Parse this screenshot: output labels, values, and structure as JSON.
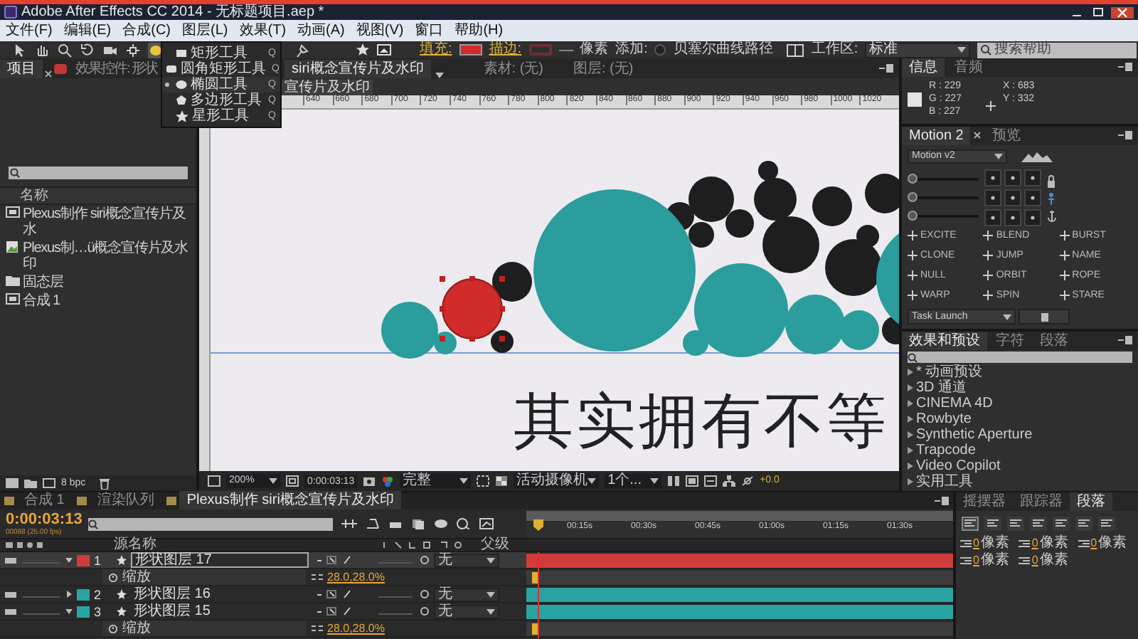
{
  "window": {
    "title": "Adobe After Effects CC 2014 - 无标题项目.aep *"
  },
  "menu": [
    "文件(F)",
    "编辑(E)",
    "合成(C)",
    "图层(L)",
    "效果(T)",
    "动画(A)",
    "视图(V)",
    "窗口",
    "帮助(H)"
  ],
  "toolbar": {
    "fill_label": "填充:",
    "stroke_label": "描边:",
    "stroke_unit": "像素",
    "add_label": "添加:",
    "bezier": {
      "label": "贝塞尔曲线路径",
      "checked": false
    },
    "workspace_label": "工作区:",
    "workspace": "标准",
    "search_placeholder": "搜索帮助"
  },
  "shape_menu": [
    {
      "kind": "rectangle",
      "label": "矩形工具",
      "shortcut": "Q",
      "selected": false
    },
    {
      "kind": "rounded_rectangle",
      "label": "圆角矩形工具",
      "shortcut": "Q",
      "selected": false
    },
    {
      "kind": "ellipse",
      "label": "椭圆工具",
      "shortcut": "Q",
      "selected": true
    },
    {
      "kind": "polygon",
      "label": "多边形工具",
      "shortcut": "Q",
      "selected": false
    },
    {
      "kind": "star",
      "label": "星形工具",
      "shortcut": "Q",
      "selected": false
    }
  ],
  "project_panel": {
    "tabs": [
      {
        "label": "项目",
        "selected": true
      },
      {
        "label": "效果控件: 形状",
        "selected": false
      }
    ],
    "column": "名称",
    "items": [
      {
        "kind": "composition",
        "name": "Plexus制作 siri概念宣传片及水"
      },
      {
        "kind": "footage",
        "name": "Plexus制…ü概念宣传片及水印"
      },
      {
        "kind": "folder",
        "name": "固态层"
      },
      {
        "kind": "composition",
        "name": "合成 1"
      }
    ],
    "bpc": "8 bpc"
  },
  "composition_panel": {
    "tabs": [
      {
        "label": "siri概念宣传片及水印",
        "selected": true
      },
      {
        "label": "素材: (无)",
        "selected": false
      },
      {
        "label": "图层: (无)",
        "selected": false
      }
    ],
    "breadcrumb": "宣传片及水印",
    "ruler": [
      "640",
      "660",
      "680",
      "700",
      "720",
      "740",
      "760",
      "780",
      "800",
      "820",
      "840",
      "860",
      "880",
      "900",
      "920",
      "940",
      "960",
      "980",
      "1000",
      "1020"
    ],
    "canvas_text": "其实拥有不等",
    "zoom": "200%",
    "time": "0:00:03:13",
    "resolution": "完整",
    "camera": "活动摄像机",
    "views": "1个...",
    "exposure": "+0.0"
  },
  "info_panel": {
    "tabs": [
      {
        "label": "信息",
        "selected": true
      },
      {
        "label": "音频",
        "selected": false
      }
    ],
    "color_values": [
      "R : 229",
      "G : 227",
      "B : 227"
    ],
    "position": [
      "X : 683",
      "Y : 332"
    ]
  },
  "motion_panel": {
    "tabs": [
      {
        "label": "Motion 2",
        "selected": true
      },
      {
        "label": "预览",
        "selected": false
      }
    ],
    "preset": "Motion v2",
    "sliders": [
      {
        "level": 0
      },
      {
        "level": 0
      },
      {
        "level": 0
      }
    ],
    "tools": [
      "EXCITE",
      "BLEND",
      "BURST",
      "CLONE",
      "JUMP",
      "NAME",
      "NULL",
      "ORBIT",
      "ROPE",
      "WARP",
      "SPIN",
      "STARE"
    ],
    "launcher": "Task Launch"
  },
  "effects_panel": {
    "tabs": [
      {
        "label": "效果和预设",
        "selected": true
      },
      {
        "label": "字符",
        "selected": false
      },
      {
        "label": "段落",
        "selected": false
      }
    ],
    "items": [
      "* 动画预设",
      "3D 通道",
      "CINEMA 4D",
      "Rowbyte",
      "Synthetic Aperture",
      "Trapcode",
      "Video Copilot",
      "实用工具"
    ]
  },
  "timeline": {
    "tabs": [
      {
        "label": "合成 1",
        "selected": false
      },
      {
        "label": "渲染队列",
        "selected": false
      },
      {
        "label": "Plexus制作 siri概念宣传片及水印",
        "selected": true
      }
    ],
    "time": "0:00:03:13",
    "frame": "00088 (25.00 fps)",
    "columns": [
      "源名称",
      "父级"
    ],
    "ruler": [
      "00:15s",
      "00:30s",
      "00:45s",
      "01:00s",
      "01:15s",
      "01:30s"
    ],
    "layers": [
      {
        "kind": "layer",
        "number": "1",
        "name": "形状图层 17",
        "color": "#d23b3b",
        "expanded": true,
        "selected": true,
        "parent": "无"
      },
      {
        "kind": "property",
        "name": "缩放",
        "value": "28.0,28.0%"
      },
      {
        "kind": "layer",
        "number": "2",
        "name": "形状图层 16",
        "color": "#2aa3a3",
        "expanded": false,
        "selected": false,
        "parent": "无"
      },
      {
        "kind": "layer",
        "number": "3",
        "name": "形状图层 15",
        "color": "#2aa3a3",
        "expanded": true,
        "selected": false,
        "parent": "无"
      },
      {
        "kind": "property",
        "name": "缩放",
        "value": "28.0,28.0%"
      }
    ]
  },
  "paragraph_panel": {
    "tabs": [
      {
        "label": "摇摆器",
        "selected": false
      },
      {
        "label": "跟踪器",
        "selected": false
      },
      {
        "label": "段落",
        "selected": true
      }
    ],
    "indents": [
      {
        "value": "0",
        "unit": "像素"
      },
      {
        "value": "0",
        "unit": "像素"
      },
      {
        "value": "0",
        "unit": "像素"
      },
      {
        "value": "0",
        "unit": "像素"
      },
      {
        "value": "0",
        "unit": "像素"
      }
    ]
  }
}
